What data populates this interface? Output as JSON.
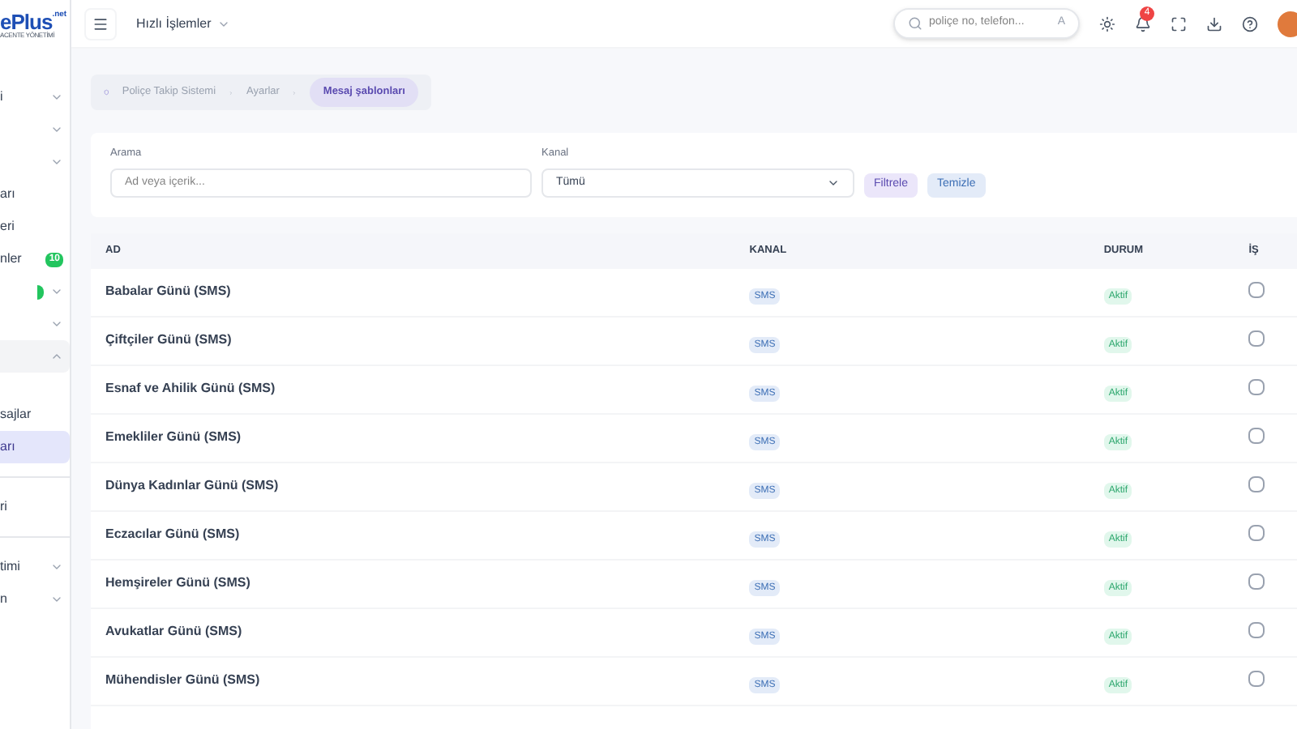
{
  "logo": {
    "text": "ePlus",
    "suffix": ".net",
    "tagline": "ACENTE YÖNETİMİ"
  },
  "sidebar": {
    "items": [
      {
        "label": "i",
        "expanded": false,
        "selected": false
      },
      {
        "expanded": false,
        "selected": false
      },
      {
        "expanded": false,
        "selected": false
      },
      {
        "label": "arı",
        "selected": false
      },
      {
        "label": "eri",
        "selected": false
      },
      {
        "label": "nler",
        "badge": "10",
        "selected": false
      },
      {
        "has_badge": true,
        "expanded": false,
        "selected": false
      },
      {
        "expanded": false,
        "selected": false
      },
      {
        "expanded": true,
        "selected": false,
        "children": [
          {
            "label": "sajlar",
            "selected": false
          },
          {
            "label": "arı",
            "selected": true
          }
        ]
      },
      {
        "label": "ri",
        "selected": false,
        "divider_before": true
      },
      {
        "label": "timi",
        "expanded": false,
        "selected": false,
        "divider_before": true
      },
      {
        "label": "n",
        "expanded": false,
        "selected": false
      }
    ]
  },
  "header": {
    "quick_actions": "Hızlı İşlemler",
    "search": {
      "placeholder": "poliçe no, telefon...",
      "shortcut": "A"
    },
    "notifications": "4"
  },
  "breadcrumb": [
    {
      "label": "Poliçe Takip Sistemi",
      "selected": false
    },
    {
      "label": "Ayarlar",
      "selected": false
    },
    {
      "label": "Mesaj şablonları",
      "selected": true
    }
  ],
  "filters": {
    "search": {
      "label": "Arama",
      "placeholder": "Ad veya içerik..."
    },
    "channel": {
      "label": "Kanal",
      "value": "Tümü"
    },
    "buttons": [
      "Filtrele",
      "Temizle"
    ]
  },
  "table": {
    "columns": [
      "AD",
      "KANAL",
      "DURUM",
      "İŞ"
    ],
    "rows": [
      {
        "name": "Babalar Günü (SMS)",
        "channel": "SMS",
        "status": "Aktif"
      },
      {
        "name": "Çiftçiler Günü (SMS)",
        "channel": "SMS",
        "status": "Aktif"
      },
      {
        "name": "Esnaf ve Ahilik Günü (SMS)",
        "channel": "SMS",
        "status": "Aktif"
      },
      {
        "name": "Emekliler Günü (SMS)",
        "channel": "SMS",
        "status": "Aktif"
      },
      {
        "name": "Dünya Kadınlar Günü (SMS)",
        "channel": "SMS",
        "status": "Aktif"
      },
      {
        "name": "Eczacılar Günü (SMS)",
        "channel": "SMS",
        "status": "Aktif"
      },
      {
        "name": "Hemşireler Günü (SMS)",
        "channel": "SMS",
        "status": "Aktif"
      },
      {
        "name": "Avukatlar Günü (SMS)",
        "channel": "SMS",
        "status": "Aktif"
      },
      {
        "name": "Mühendisler Günü (SMS)",
        "channel": "SMS",
        "status": "Aktif"
      }
    ]
  }
}
